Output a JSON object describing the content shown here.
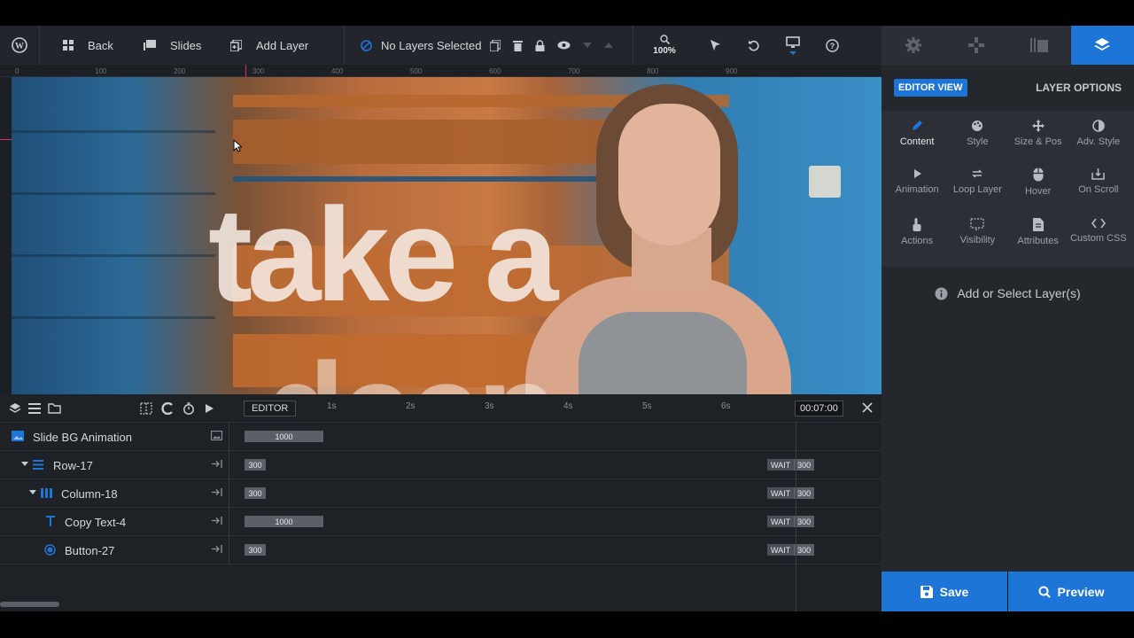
{
  "toolbar": {
    "back_label": "Back",
    "slides_label": "Slides",
    "add_layer_label": "Add Layer",
    "selection_status": "No Layers Selected",
    "zoom": "100%"
  },
  "ruler_ticks": [
    "0",
    "100",
    "200",
    "300",
    "400",
    "500",
    "600",
    "700",
    "800",
    "900"
  ],
  "canvas": {
    "headline_line1": "take a",
    "headline_line2": "deep"
  },
  "right_panel": {
    "editor_view_label": "EDITOR VIEW",
    "layer_options_label": "LAYER OPTIONS",
    "tools": [
      {
        "label": "Content",
        "icon": "pencil-icon"
      },
      {
        "label": "Style",
        "icon": "palette-icon"
      },
      {
        "label": "Size & Pos",
        "icon": "move-icon"
      },
      {
        "label": "Adv. Style",
        "icon": "contrast-icon"
      },
      {
        "label": "Animation",
        "icon": "play-icon"
      },
      {
        "label": "Loop Layer",
        "icon": "loop-icon"
      },
      {
        "label": "Hover",
        "icon": "mouse-icon"
      },
      {
        "label": "On Scroll",
        "icon": "scroll-icon"
      },
      {
        "label": "Actions",
        "icon": "hand-pointer-icon"
      },
      {
        "label": "Visibility",
        "icon": "visibility-icon"
      },
      {
        "label": "Attributes",
        "icon": "document-icon"
      },
      {
        "label": "Custom CSS",
        "icon": "code-icon"
      }
    ],
    "hint": "Add or Select Layer(s)"
  },
  "buttons": {
    "save_label": "Save",
    "preview_label": "Preview"
  },
  "timeline": {
    "editor_tag": "EDITOR",
    "time_marks": [
      "1s",
      "2s",
      "3s",
      "4s",
      "5s",
      "6s"
    ],
    "duration": "00:07:00",
    "wait_label": "WAIT",
    "rows": [
      {
        "name": "Slide BG Animation",
        "bar": "1000"
      },
      {
        "name": "Row-17",
        "bar": "300",
        "wait": "300"
      },
      {
        "name": "Column-18",
        "bar": "300",
        "wait": "300"
      },
      {
        "name": "Copy Text-4",
        "bar": "1000",
        "wait": "300"
      },
      {
        "name": "Button-27",
        "bar": "300",
        "wait": "300"
      }
    ]
  },
  "colors": {
    "accent": "#1e75d8",
    "panel_bg": "#24282d",
    "toolbar_bg": "#22262c"
  }
}
